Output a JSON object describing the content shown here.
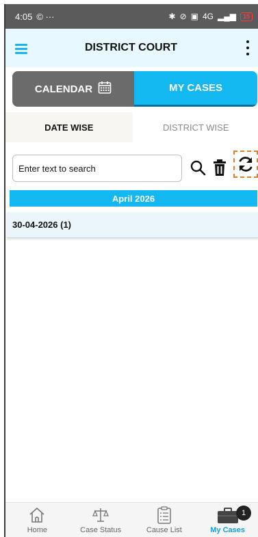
{
  "status_bar": {
    "time": "4:05",
    "left_icons": "© ···",
    "network": "4G",
    "battery": "15"
  },
  "app_bar": {
    "title": "DISTRICT COURT"
  },
  "segment": {
    "calendar_label": "CALENDAR",
    "my_cases_label": "MY CASES"
  },
  "tabs": {
    "date_wise": "DATE WISE",
    "district_wise": "DISTRICT WISE"
  },
  "search": {
    "placeholder": "Enter text to search"
  },
  "month": {
    "label": "April 2026"
  },
  "list": {
    "items": [
      {
        "label": "30-04-2026 (1)"
      }
    ]
  },
  "bottom_nav": {
    "items": [
      {
        "label": "Home",
        "icon": "home-icon"
      },
      {
        "label": "Case Status",
        "icon": "scales-icon"
      },
      {
        "label": "Cause List",
        "icon": "clipboard-icon"
      },
      {
        "label": "My Cases",
        "icon": "briefcase-icon",
        "badge": "1"
      }
    ]
  },
  "colors": {
    "accent": "#14b8f0",
    "app_bar_bg": "#e7f8fe",
    "segment_inactive": "#6b6b6b",
    "status_bar": "#5b5b5b",
    "active_nav": "#1a9ed6"
  }
}
